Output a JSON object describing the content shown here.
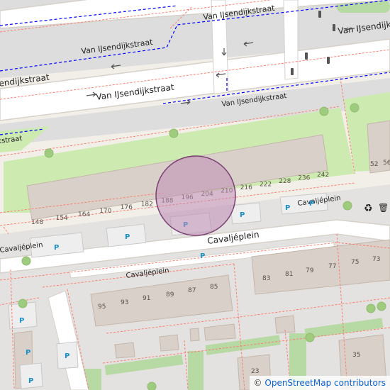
{
  "streets": {
    "van_ijsendijkstraat": "Van IJsendijkstraat",
    "cavaljeplein": "Cavaljéplein"
  },
  "house_numbers": {
    "north_row": [
      "148",
      "154",
      "164",
      "170",
      "176",
      "182",
      "188",
      "196",
      "204",
      "210",
      "216",
      "222",
      "228",
      "236",
      "242"
    ],
    "east_edge": [
      "52",
      "56"
    ],
    "south_upper_row": [
      "83",
      "81",
      "79",
      "77",
      "75",
      "73"
    ],
    "south_lower_row": [
      "95",
      "93",
      "91",
      "89",
      "87",
      "85"
    ],
    "bottom": [
      "35",
      "23"
    ]
  },
  "parking_symbol": "P",
  "recycling_symbol": "♻",
  "waste_symbol": "🗑",
  "attribution": {
    "symbol": "©",
    "text": "OpenStreetMap contributors"
  },
  "colors": {
    "background": "#f2efe9",
    "road": "#ffffff",
    "road_casing": "#d6d1c9",
    "footway": "#fa8072",
    "cycleway": "#0000ff",
    "park": "#cdebb0",
    "building": "#d9d0c9",
    "building_outline": "#c4b6ab",
    "parking": "#eeeeee",
    "tree": "#9ecb7e",
    "marker_fill": "#c08cb4",
    "marker_stroke": "#7a3f73",
    "parking_text": "#1a8fc9"
  }
}
